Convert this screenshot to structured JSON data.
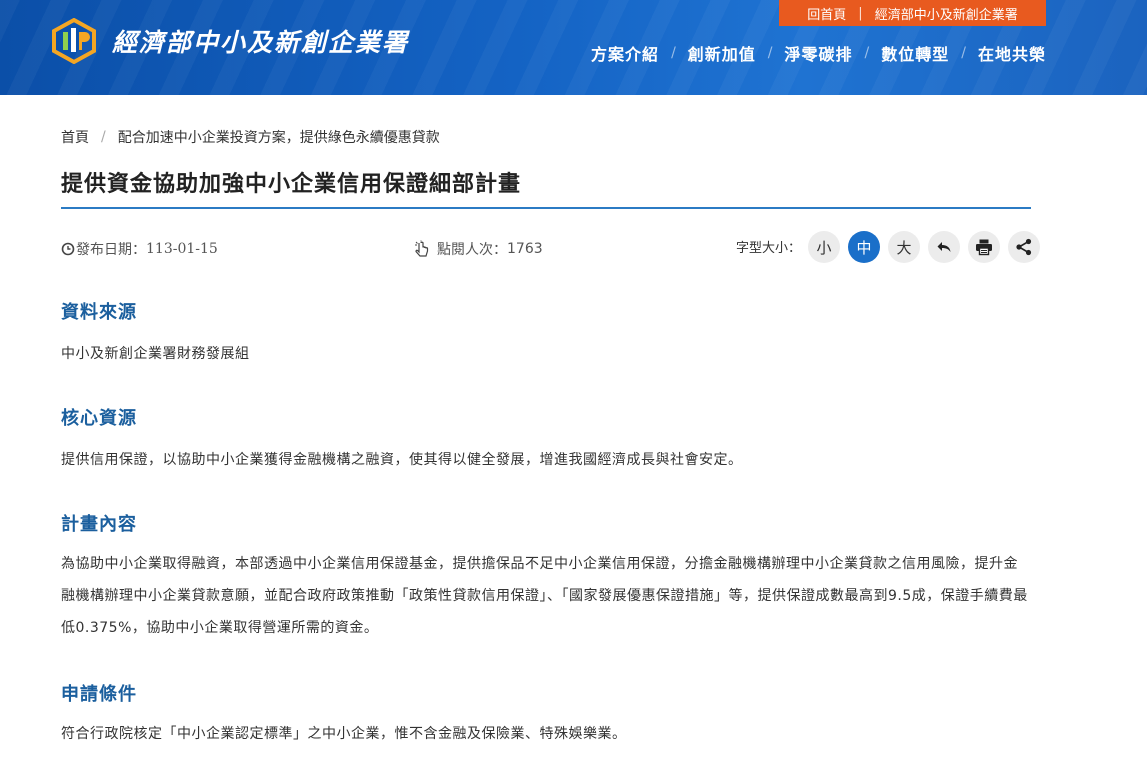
{
  "header": {
    "logo_text": "經濟部中小及新創企業署",
    "topbar": {
      "home": "回首頁",
      "separator": "|",
      "agency": "經濟部中小及新創企業署"
    },
    "nav": [
      "方案介紹",
      "創新加值",
      "淨零碳排",
      "數位轉型",
      "在地共榮"
    ],
    "nav_separator": "/"
  },
  "breadcrumb": {
    "home": "首頁",
    "separator": "/",
    "current": "配合加速中小企業投資方案，提供綠色永續優惠貸款"
  },
  "page_title": "提供資金協助加強中小企業信用保證細部計畫",
  "meta": {
    "date_label": "發布日期：",
    "date": "113-01-15",
    "views_label": "點閱人次：",
    "views": "1763",
    "font_size_label": "字型大小：",
    "font_sizes": [
      "小",
      "中",
      "大"
    ],
    "active_font_size": "中"
  },
  "sections": [
    {
      "heading": "資料來源",
      "body": "中小及新創企業署財務發展組"
    },
    {
      "heading": "核心資源",
      "body": "提供信用保證，以協助中小企業獲得金融機構之融資，使其得以健全發展，增進我國經濟成長與社會安定。"
    },
    {
      "heading": "計畫內容",
      "body": "為協助中小企業取得融資，本部透過中小企業信用保證基金，提供擔保品不足中小企業信用保證，分擔金融機構辦理中小企業貸款之信用風險，提升金融機構辦理中小企業貸款意願，並配合政府政策推動「政策性貸款信用保證」、「國家發展優惠保證措施」等，提供保證成數最高到9.5成，保證手續費最低0.375%，協助中小企業取得營運所需的資金。"
    },
    {
      "heading": "申請條件",
      "body": "符合行政院核定「中小企業認定標準」之中小企業，惟不含金融及保險業、特殊娛樂業。"
    }
  ],
  "colors": {
    "header": "#1463c4",
    "topbar": "#e85a1f",
    "heading": "#1b5f9e",
    "active": "#1a6fc9",
    "rule": "#2b7bc4"
  },
  "icons": [
    "clock-icon",
    "pointer-icon",
    "back-icon",
    "print-icon",
    "share-icon"
  ]
}
